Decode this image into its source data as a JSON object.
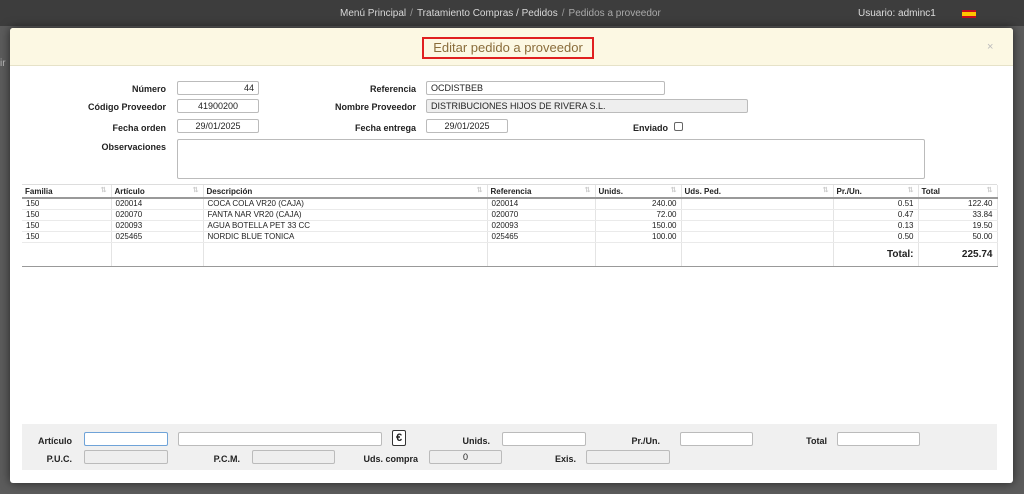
{
  "breadcrumb": {
    "home": "Menú Principal",
    "section": "Tratamiento Compras / Pedidos",
    "current": "Pedidos a proveedor"
  },
  "user": {
    "label": "Usuario: adminc1"
  },
  "background": {
    "side_label": "ir"
  },
  "modal": {
    "title": "Editar pedido a proveedor",
    "close": "×"
  },
  "form": {
    "numero_label": "Número",
    "numero": "44",
    "referencia_label": "Referencia",
    "referencia": "OCDISTBEB",
    "codigo_proveedor_label": "Código Proveedor",
    "codigo_proveedor": "41900200",
    "nombre_proveedor_label": "Nombre Proveedor",
    "nombre_proveedor": "DISTRIBUCIONES HIJOS DE RIVERA S.L.",
    "fecha_orden_label": "Fecha orden",
    "fecha_orden": "29/01/2025",
    "fecha_entrega_label": "Fecha entrega",
    "fecha_entrega": "29/01/2025",
    "enviado_label": "Enviado",
    "enviado_checked": false,
    "observaciones_label": "Observaciones",
    "observaciones": ""
  },
  "table": {
    "columns": [
      "Familia",
      "Artículo",
      "Descripción",
      "Referencia",
      "Unids.",
      "Uds. Ped.",
      "Pr./Un.",
      "Total"
    ],
    "rows": [
      {
        "familia": "150",
        "articulo": "020014",
        "descripcion": "COCA COLA VR20 (CAJA)",
        "referencia": "020014",
        "unids": "240.00",
        "uds_ped": "",
        "pr_un": "0.51",
        "total": "122.40"
      },
      {
        "familia": "150",
        "articulo": "020070",
        "descripcion": "FANTA NAR VR20 (CAJA)",
        "referencia": "020070",
        "unids": "72.00",
        "uds_ped": "",
        "pr_un": "0.47",
        "total": "33.84"
      },
      {
        "familia": "150",
        "articulo": "020093",
        "descripcion": "AGUA BOTELLA PET 33 CC",
        "referencia": "020093",
        "unids": "150.00",
        "uds_ped": "",
        "pr_un": "0.13",
        "total": "19.50"
      },
      {
        "familia": "150",
        "articulo": "025465",
        "descripcion": "NORDIC BLUE TONICA",
        "referencia": "025465",
        "unids": "100.00",
        "uds_ped": "",
        "pr_un": "0.50",
        "total": "50.00"
      }
    ],
    "total_label": "Total:",
    "total_value": "225.74"
  },
  "entry": {
    "articulo_label": "Artículo",
    "articulo": "",
    "descripcion": "",
    "euro_button": "€",
    "unids_label": "Unids.",
    "unids": "",
    "pr_un_label": "Pr./Un.",
    "pr_un": "",
    "total_label": "Total",
    "total": "",
    "puc_label": "P.U.C.",
    "puc": "",
    "pcm_label": "P.C.M.",
    "pcm": "",
    "uds_compra_label": "Uds. compra",
    "uds_compra": "0",
    "exis_label": "Exis.",
    "exis": ""
  },
  "colors": {
    "header_bg": "#fcf8e3",
    "title_text": "#8a6d3b",
    "title_border": "#e02020",
    "topbar_bg": "#3d3d3d"
  }
}
